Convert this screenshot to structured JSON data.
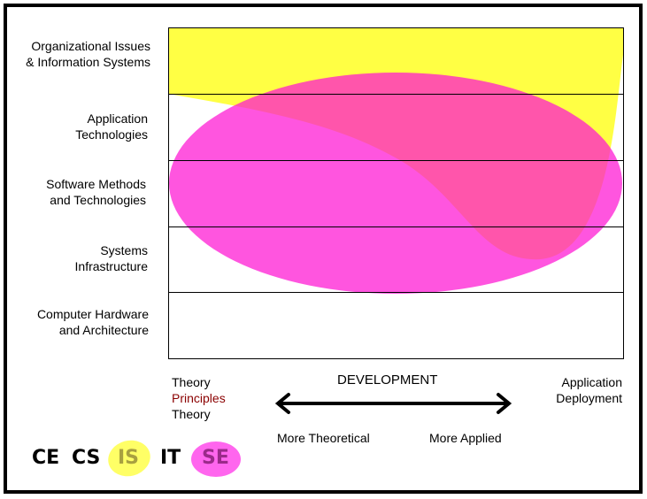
{
  "rows": [
    "Organizational Issues & Information Systems",
    "Application Technologies",
    "Software Methods and Technologies",
    "Systems Infrastructure",
    "Computer Hardware and Architecture"
  ],
  "rows_lines": [
    [
      "Organizational Issues",
      "& Information Systems"
    ],
    [
      "Application",
      "Technologies"
    ],
    [
      "Software Methods",
      "and Technologies"
    ],
    [
      "Systems",
      "Infrastructure"
    ],
    [
      "Computer Hardware",
      "and Architecture"
    ]
  ],
  "axis": {
    "left": [
      "Theory",
      "Principles",
      "Theory"
    ],
    "center": "DEVELOPMENT",
    "right": [
      "Application",
      "Deployment"
    ],
    "more_theoretical": "More Theoretical",
    "more_applied": "More Applied"
  },
  "legend": [
    {
      "label": "CE"
    },
    {
      "label": "CS"
    },
    {
      "label": "IS",
      "highlight": "#ffff66"
    },
    {
      "label": "IT"
    },
    {
      "label": "SE",
      "highlight": "#ff66ee"
    }
  ],
  "colors": {
    "IS": "#ffff44",
    "SE": "#ff33dd",
    "principles": "#8b0000"
  }
}
